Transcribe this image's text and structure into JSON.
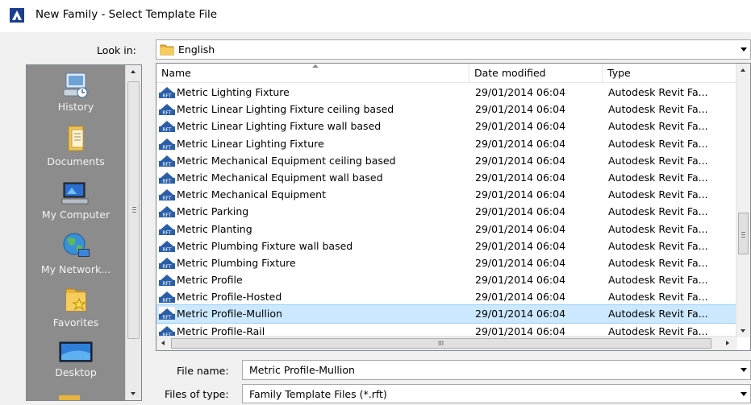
{
  "window": {
    "title": "New Family - Select Template File"
  },
  "lookin": {
    "label": "Look in:",
    "value": "English"
  },
  "places": [
    {
      "label": "History",
      "icon": "history-icon"
    },
    {
      "label": "Documents",
      "icon": "documents-icon"
    },
    {
      "label": "My Computer",
      "icon": "my-computer-icon"
    },
    {
      "label": "My Network...",
      "icon": "my-network-icon"
    },
    {
      "label": "Favorites",
      "icon": "favorites-icon"
    },
    {
      "label": "Desktop",
      "icon": "desktop-icon"
    }
  ],
  "columns": {
    "name": "Name",
    "date": "Date modified",
    "type": "Type"
  },
  "files": [
    {
      "name": "Metric Lighting Fixture",
      "date": "29/01/2014 06:04",
      "type": "Autodesk Revit Fa..."
    },
    {
      "name": "Metric Linear Lighting Fixture ceiling based",
      "date": "29/01/2014 06:04",
      "type": "Autodesk Revit Fa..."
    },
    {
      "name": "Metric Linear Lighting Fixture wall based",
      "date": "29/01/2014 06:04",
      "type": "Autodesk Revit Fa..."
    },
    {
      "name": "Metric Linear Lighting Fixture",
      "date": "29/01/2014 06:04",
      "type": "Autodesk Revit Fa..."
    },
    {
      "name": "Metric Mechanical Equipment ceiling based",
      "date": "29/01/2014 06:04",
      "type": "Autodesk Revit Fa..."
    },
    {
      "name": "Metric Mechanical Equipment wall based",
      "date": "29/01/2014 06:04",
      "type": "Autodesk Revit Fa..."
    },
    {
      "name": "Metric Mechanical Equipment",
      "date": "29/01/2014 06:04",
      "type": "Autodesk Revit Fa..."
    },
    {
      "name": "Metric Parking",
      "date": "29/01/2014 06:04",
      "type": "Autodesk Revit Fa..."
    },
    {
      "name": "Metric Planting",
      "date": "29/01/2014 06:04",
      "type": "Autodesk Revit Fa..."
    },
    {
      "name": "Metric Plumbing Fixture wall based",
      "date": "29/01/2014 06:04",
      "type": "Autodesk Revit Fa..."
    },
    {
      "name": "Metric Plumbing Fixture",
      "date": "29/01/2014 06:04",
      "type": "Autodesk Revit Fa..."
    },
    {
      "name": "Metric Profile",
      "date": "29/01/2014 06:04",
      "type": "Autodesk Revit Fa..."
    },
    {
      "name": "Metric Profile-Hosted",
      "date": "29/01/2014 06:04",
      "type": "Autodesk Revit Fa..."
    },
    {
      "name": "Metric Profile-Mullion",
      "date": "29/01/2014 06:04",
      "type": "Autodesk Revit Fa...",
      "selected": true
    },
    {
      "name": "Metric Profile-Rail",
      "date": "29/01/2014 06:04",
      "type": "Autodesk Revit Fa..."
    }
  ],
  "file_icon_text": "RFT",
  "filename": {
    "label": "File name:",
    "value": "Metric Profile-Mullion"
  },
  "filetype": {
    "label": "Files of type:",
    "value": "Family Template Files  (*.rft)"
  },
  "hscroll_grip": "III",
  "colors": {
    "selection": "#cce8ff",
    "places_bg": "#8c8c8c",
    "rft_icon": "#2a5fa8"
  }
}
